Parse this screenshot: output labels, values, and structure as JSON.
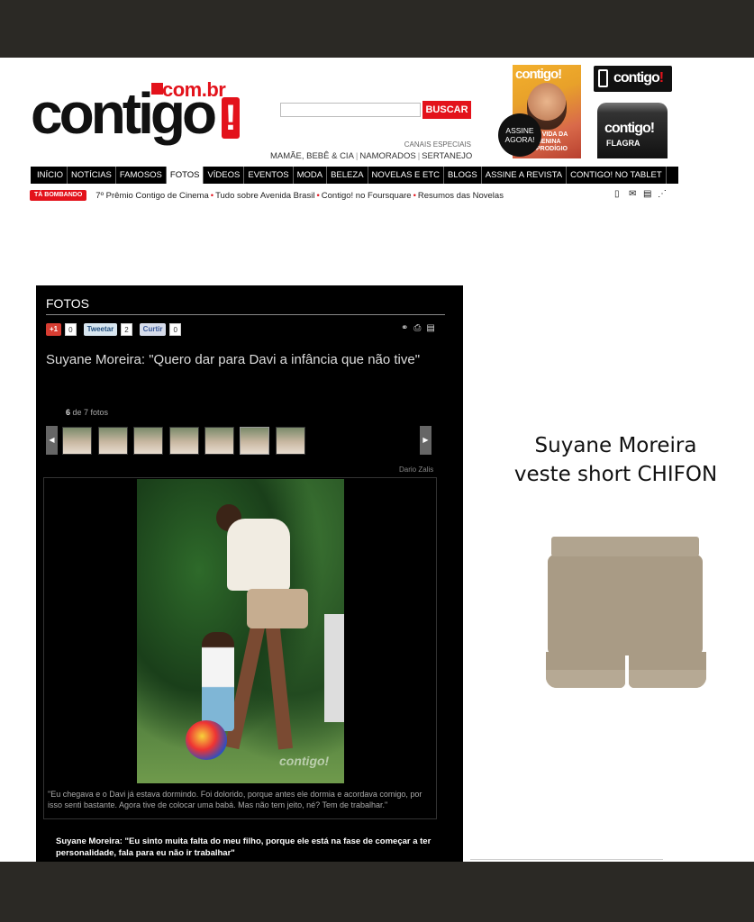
{
  "header": {
    "logo_word": "contigo",
    "logo_com": "com.br",
    "logo_bang": "!",
    "search_placeholder": "",
    "search_button": "BUSCAR",
    "canais_label": "CANAIS ESPECIAIS",
    "canais": [
      "MAMÃE, BEBÊ & CIA",
      "NAMORADOS",
      "SERTANEJO"
    ],
    "sep": "|"
  },
  "promo": {
    "mag_masthead": "contigo!",
    "mag_caption": "A VIDA DA MENINA PRODÍGIO",
    "assine": "ASSINE AGORA!",
    "app_label": "contigo",
    "app_bang": "!",
    "flagra_brand": "contigo!",
    "flagra_label": "FLAGRA"
  },
  "nav": {
    "items": [
      "INÍCIO",
      "NOTÍCIAS",
      "FAMOSOS",
      "FOTOS",
      "VÍDEOS",
      "EVENTOS",
      "MODA",
      "BELEZA",
      "NOVELAS E ETC",
      "BLOGS",
      "ASSINE A REVISTA",
      "CONTIGO! NO TABLET"
    ],
    "active": "FOTOS"
  },
  "trending": {
    "badge": "TÁ BOMBANDO",
    "links": [
      "7º Prêmio Contigo de Cinema",
      "Tudo sobre Avenida Brasil",
      "Contigo! no Foursquare",
      "Resumos das Novelas"
    ],
    "bullet": "•"
  },
  "gallery": {
    "section": "FOTOS",
    "share": {
      "gplus": "+1",
      "gplus_count": "0",
      "tweet": "Tweetar",
      "tweet_count": "2",
      "like": "Curtir",
      "like_count": "0"
    },
    "title": "Suyane Moreira: \"Quero dar para Davi a infância que não tive\"",
    "current": "6",
    "counter_rest": "de 7 fotos",
    "credit": "Dario Zalis",
    "watermark": "contigo!",
    "caption": "\"Eu chegava e o Davi já estava dormindo. Foi dolorido, porque antes ele dormia e acordava comigo, por isso senti bastante. Agora tive de colocar uma babá. Mas não tem jeito, né? Tem de trabalhar.\"",
    "quote": "Suyane Moreira: \"Eu sinto muita falta do meu filho, porque ele está na fase de começar a ter personalidade, fala para eu não ir trabalhar\""
  },
  "ad": {
    "line1": "Suyane Moreira",
    "line2": "veste short CHIFON"
  },
  "colors": {
    "brand_red": "#e3121b",
    "nav_bg": "#000000",
    "panel_bg": "#000000"
  }
}
